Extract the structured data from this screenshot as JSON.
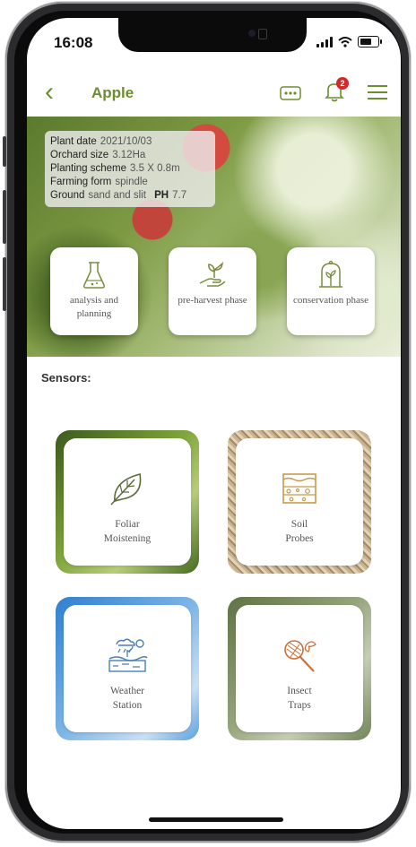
{
  "status_bar": {
    "time": "16:08"
  },
  "app_bar": {
    "title": "Apple",
    "notification_count": "2",
    "icons": [
      "back-chevron-icon",
      "chat-icon",
      "bell-icon",
      "menu-icon"
    ]
  },
  "plant_info": {
    "plant_date_label": "Plant date",
    "plant_date": "2021/10/03",
    "orchard_size_label": "Orchard size",
    "orchard_size": "3.12Ha",
    "planting_scheme_label": "Planting scheme",
    "planting_scheme": "3.5 X 0.8m",
    "farming_form_label": "Farming form",
    "farming_form": "spindle",
    "ground_label": "Ground",
    "ground": "sand and slit",
    "ph_label": "PH",
    "ph": "7.7"
  },
  "phases": [
    {
      "label": "analysis and planning",
      "icon": "flask-icon"
    },
    {
      "label": "pre-harvest phase",
      "icon": "hand-sprout-icon"
    },
    {
      "label": "conservation phase",
      "icon": "bell-jar-plant-icon"
    }
  ],
  "sensors": {
    "title": "Sensors:",
    "items": [
      {
        "label": "Foliar\nMoistening",
        "icon": "leaf-icon"
      },
      {
        "label": "Soil\nProbes",
        "icon": "soil-layers-icon"
      },
      {
        "label": "Weather\nStation",
        "icon": "weather-icon"
      },
      {
        "label": "Insect\nTraps",
        "icon": "butterfly-net-icon"
      }
    ]
  },
  "colors": {
    "accent": "#6b8e2f",
    "badge": "#d62828",
    "icon_gold": "#c99a4b"
  }
}
